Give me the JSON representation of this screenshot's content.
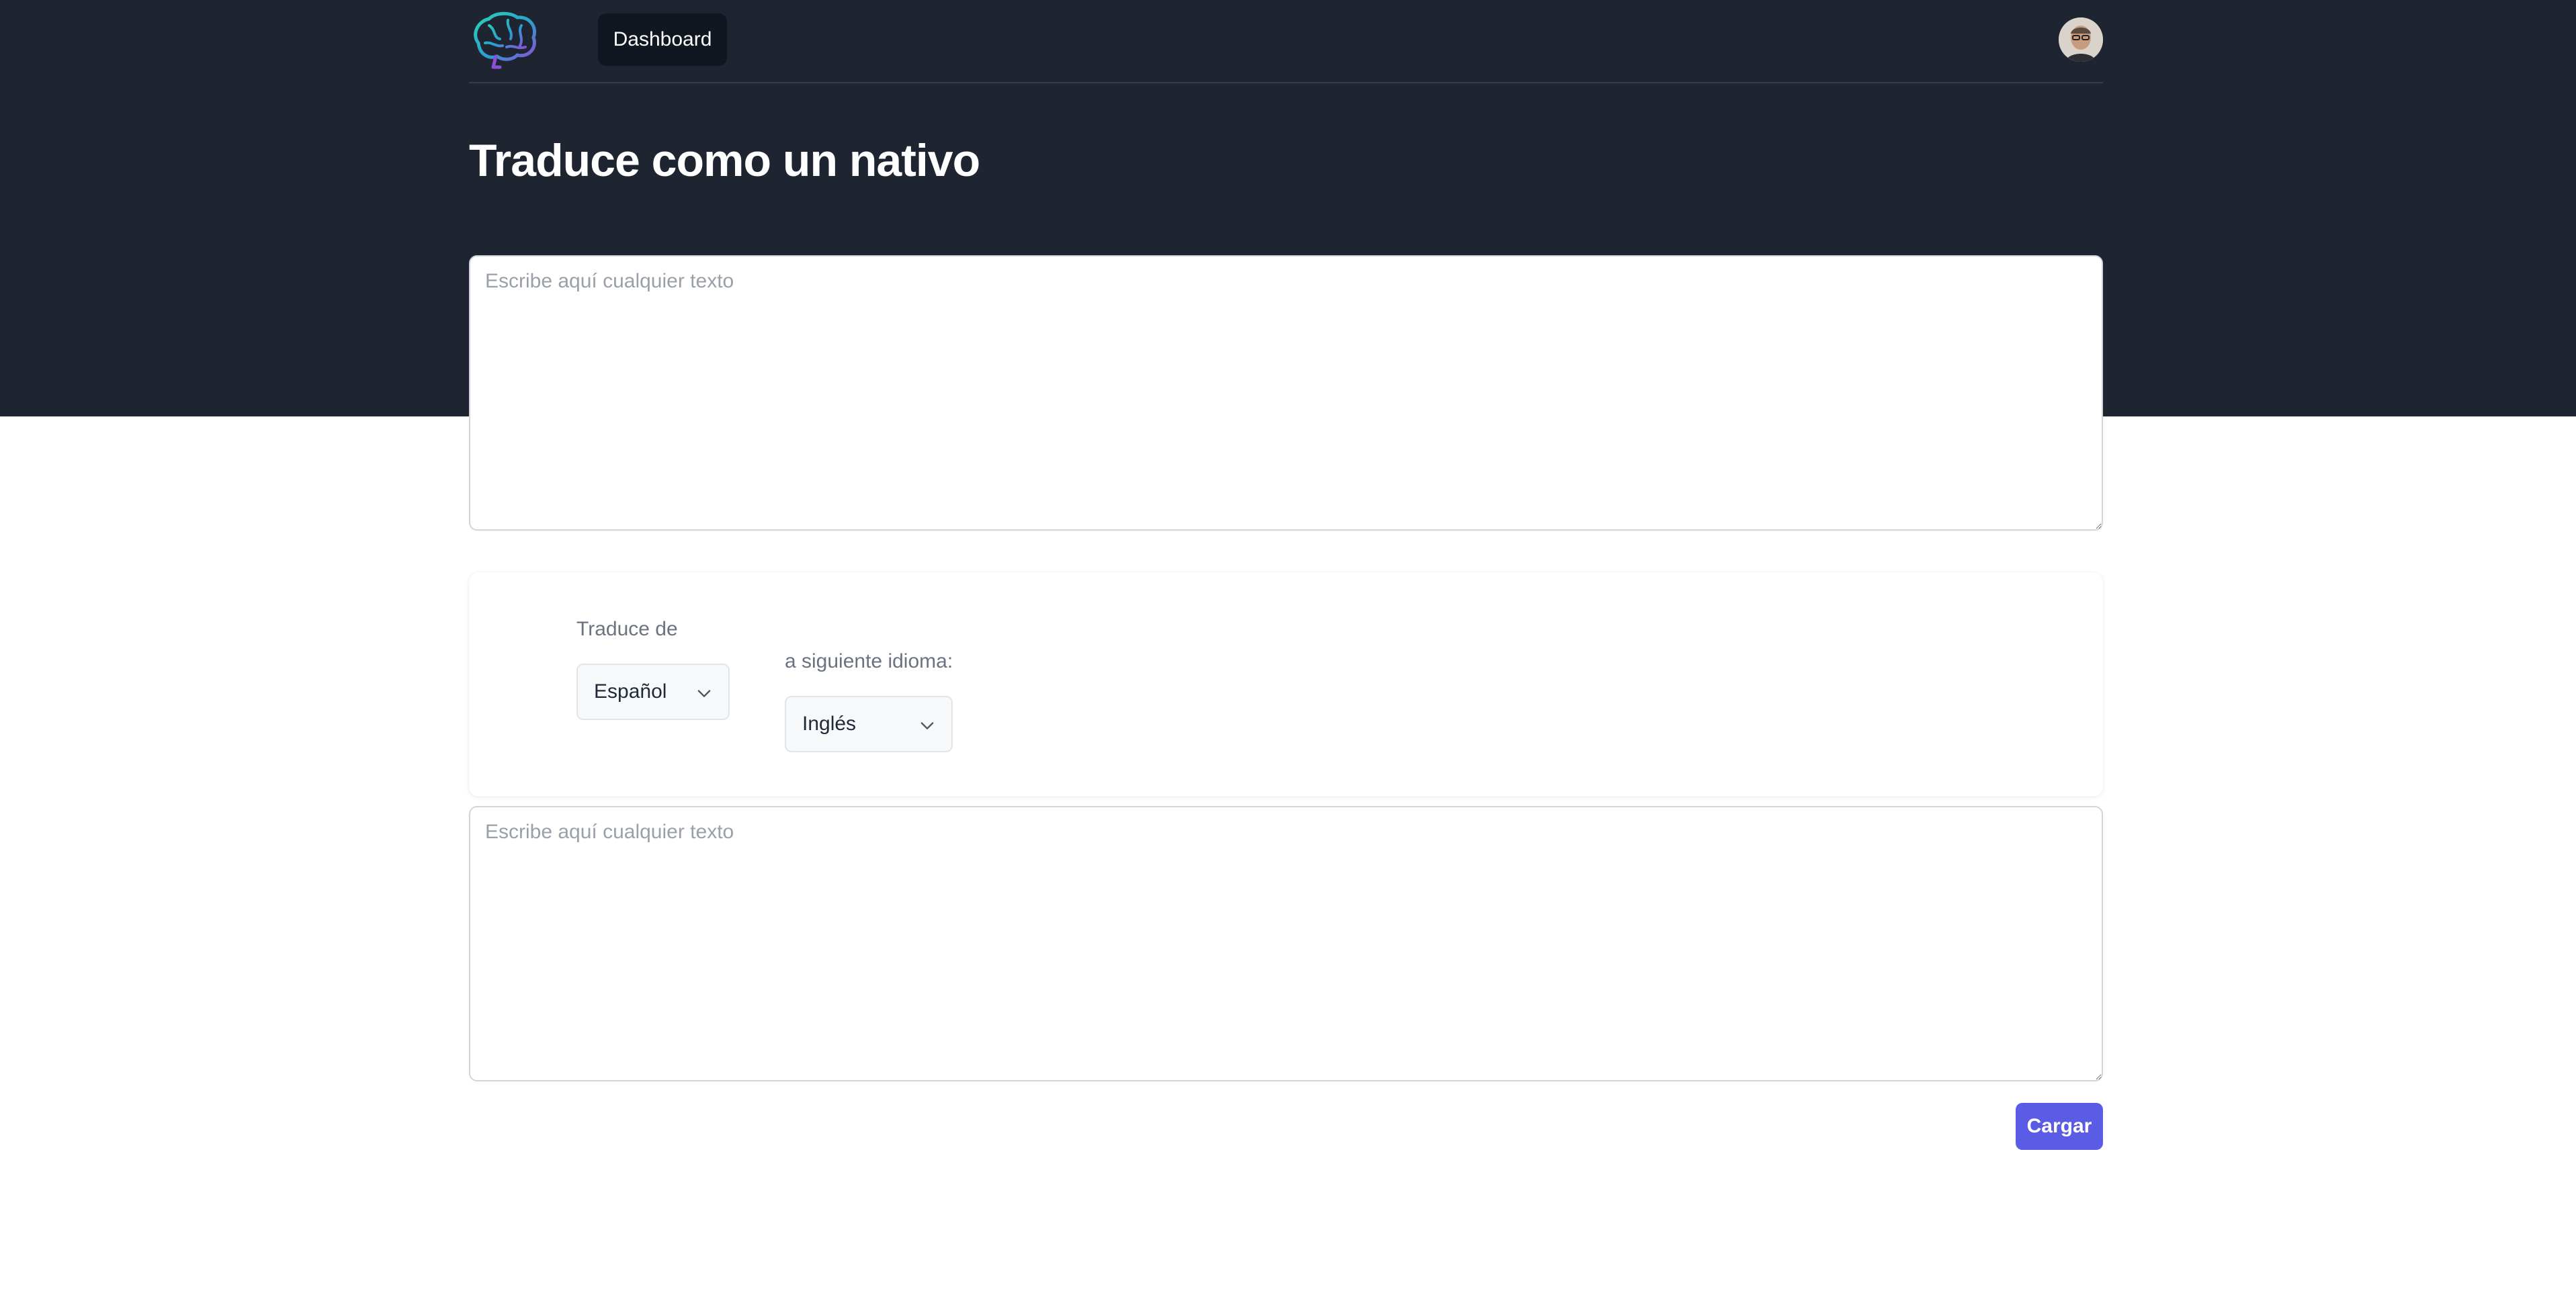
{
  "nav": {
    "logo": "brain-logo-icon",
    "links": [
      {
        "label": "Dashboard",
        "active": true
      }
    ],
    "avatar": "user-avatar"
  },
  "page": {
    "title": "Traduce como un nativo"
  },
  "source_text": {
    "value": "",
    "placeholder": "Escribe aquí cualquier texto"
  },
  "languages": {
    "from_label": "Traduce de",
    "from_value": "Español",
    "to_label": "a siguiente idioma:",
    "to_value": "Inglés"
  },
  "target_text": {
    "value": "",
    "placeholder": "Escribe aquí cualquier texto"
  },
  "actions": {
    "submit_label": "Cargar"
  },
  "colors": {
    "header_bg": "#1f2530",
    "active_nav_bg": "#111720",
    "accent": "#5b5ce6",
    "page_bg": "#ffffff"
  }
}
